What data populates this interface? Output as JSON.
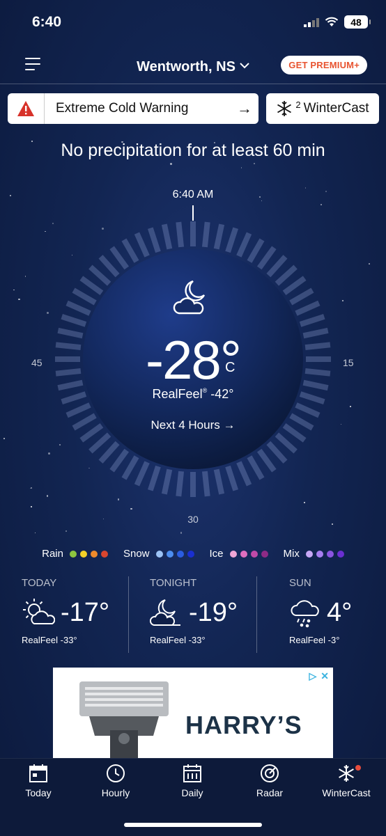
{
  "status": {
    "time": "6:40",
    "battery": "48"
  },
  "header": {
    "location": "Wentworth, NS",
    "premium_label": "GET PREMIUM+"
  },
  "alerts": {
    "warning": "Extreme Cold Warning",
    "wintercast_count": "2",
    "wintercast_label": "WinterCast"
  },
  "precip_message": "No precipitation for at least 60 min",
  "dial": {
    "time": "6:40 AM",
    "label_left": "45",
    "label_right": "15",
    "label_bottom": "30"
  },
  "current": {
    "condition_icon": "moon-cloud-icon",
    "temperature": "-28°",
    "unit": "C",
    "realfeel_label": "RealFeel",
    "realfeel_value": "-42°",
    "next_hours": "Next 4 Hours"
  },
  "legend": [
    {
      "label": "Rain",
      "colors": [
        "#8dc63f",
        "#f2d028",
        "#ee8a2c",
        "#d9462f"
      ]
    },
    {
      "label": "Snow",
      "colors": [
        "#9cc3f5",
        "#4d8ef0",
        "#2b5de0",
        "#1a2fd0"
      ]
    },
    {
      "label": "Ice",
      "colors": [
        "#f0a7d6",
        "#e06fc0",
        "#c04aa8",
        "#8e2b86"
      ]
    },
    {
      "label": "Mix",
      "colors": [
        "#c7a7f5",
        "#a77ef0",
        "#8a55e0",
        "#6a2fd0"
      ]
    }
  ],
  "forecast": [
    {
      "label": "TODAY",
      "icon": "sun-cloud-icon",
      "temp": "-17°",
      "realfeel": "RealFeel -33°"
    },
    {
      "label": "TONIGHT",
      "icon": "moon-cloud-icon",
      "temp": "-19°",
      "realfeel": "RealFeel -33°"
    },
    {
      "label": "SUN",
      "icon": "cloud-rain-snow-icon",
      "temp": "4°",
      "realfeel": "RealFeel -3°"
    }
  ],
  "ad": {
    "brand": "HARRY’S"
  },
  "tabs": [
    {
      "label": "Today",
      "icon": "calendar-day-icon"
    },
    {
      "label": "Hourly",
      "icon": "clock-icon"
    },
    {
      "label": "Daily",
      "icon": "calendar-icon"
    },
    {
      "label": "Radar",
      "icon": "radar-icon"
    },
    {
      "label": "WinterCast",
      "icon": "snowflake-icon"
    }
  ]
}
